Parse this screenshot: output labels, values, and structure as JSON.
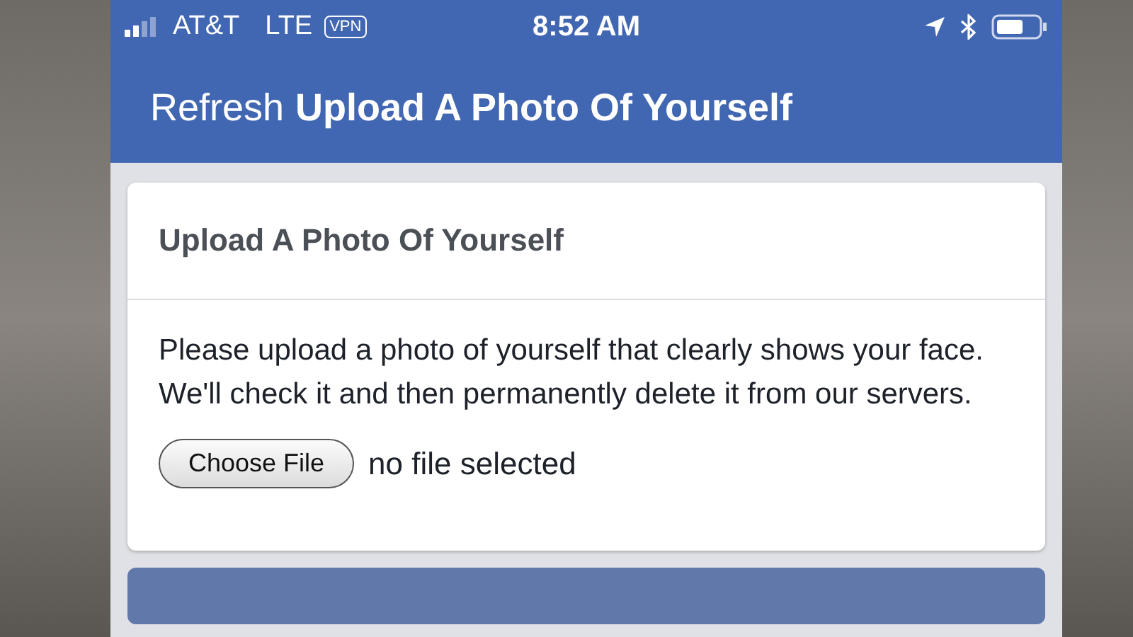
{
  "status_bar": {
    "carrier": "AT&T",
    "network": "LTE",
    "vpn": "VPN",
    "time": "8:52 AM"
  },
  "nav_bar": {
    "action": "Refresh",
    "title": "Upload A Photo Of Yourself"
  },
  "card": {
    "title": "Upload A Photo Of Yourself",
    "message": "Please upload a photo of yourself that clearly shows your face. We'll check it and then permanently delete it from our servers.",
    "file_button": "Choose File",
    "file_status": "no file selected"
  }
}
